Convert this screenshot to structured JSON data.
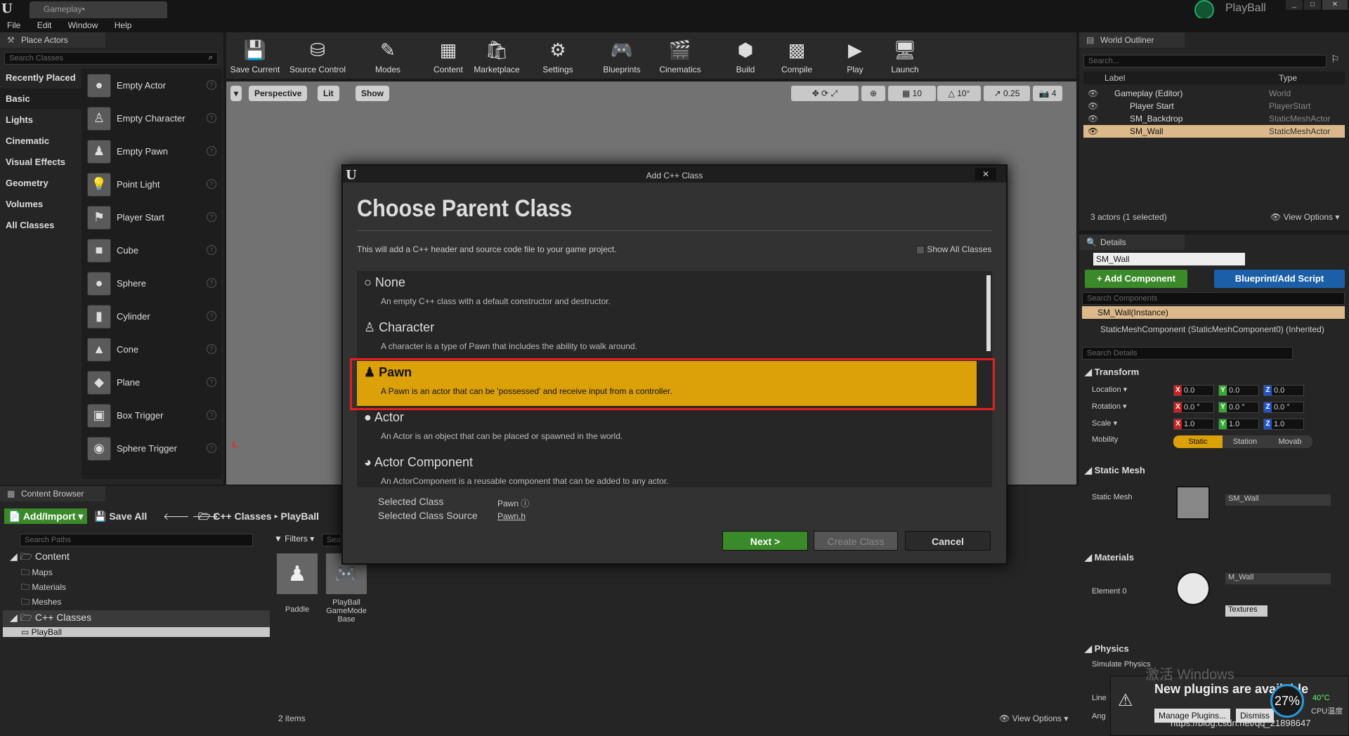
{
  "window": {
    "app_logo": "U",
    "doc_tab": "Gameplay•",
    "project_name": "PlayBall"
  },
  "menu": [
    "File",
    "Edit",
    "Window",
    "Help"
  ],
  "place_actors": {
    "tab": "Place Actors",
    "search_placeholder": "Search Classes",
    "categories": [
      "Recently Placed",
      "Basic",
      "Lights",
      "Cinematic",
      "Visual Effects",
      "Geometry",
      "Volumes",
      "All Classes"
    ],
    "selected_category": "Basic",
    "items": [
      "Empty Actor",
      "Empty Character",
      "Empty Pawn",
      "Point Light",
      "Player Start",
      "Cube",
      "Sphere",
      "Cylinder",
      "Cone",
      "Plane",
      "Box Trigger",
      "Sphere Trigger"
    ]
  },
  "toolbar": {
    "buttons": [
      "Save Current",
      "Source Control",
      "Modes",
      "Content",
      "Marketplace",
      "Settings",
      "Blueprints",
      "Cinematics",
      "Build",
      "Compile",
      "Play",
      "Launch"
    ]
  },
  "viewport": {
    "perspective": "Perspective",
    "lit": "Lit",
    "show": "Show",
    "grid_snap": "10",
    "rotation_snap": "10°",
    "scale_snap": "0.25",
    "camera_speed": "4"
  },
  "world_outliner": {
    "tab": "World Outliner",
    "search_placeholder": "Search...",
    "col_label": "Label",
    "col_type": "Type",
    "rows": [
      {
        "label": "Gameplay (Editor)",
        "type": "World"
      },
      {
        "label": "Player Start",
        "type": "PlayerStart"
      },
      {
        "label": "SM_Backdrop",
        "type": "StaticMeshActor"
      },
      {
        "label": "SM_Wall",
        "type": "StaticMeshActor"
      }
    ],
    "status": "3 actors (1 selected)",
    "view_options": "View Options"
  },
  "details": {
    "tab": "Details",
    "name": "SM_Wall",
    "add_component": "+ Add Component",
    "blueprint_script": "Blueprint/Add Script",
    "search_components": "Search Components",
    "instance": "SM_Wall(Instance)",
    "component": "StaticMeshComponent (StaticMeshComponent0) (Inherited)",
    "search_details": "Search Details",
    "transform_header": "Transform",
    "location_label": "Location",
    "rotation_label": "Rotation",
    "scale_label": "Scale",
    "mobility_label": "Mobility",
    "location": [
      "0.0",
      "0.0",
      "0.0"
    ],
    "rotation": [
      "0.0 °",
      "0.0 °",
      "0.0 °"
    ],
    "scale": [
      "1.0",
      "1.0",
      "1.0"
    ],
    "mobility": [
      "Static",
      "Station",
      "Movab"
    ],
    "static_mesh_header": "Static Mesh",
    "static_mesh_label": "Static Mesh",
    "static_mesh_value": "SM_Wall",
    "materials_header": "Materials",
    "element_label": "Element 0",
    "material_value": "M_Wall",
    "textures": "Textures",
    "physics_header": "Physics",
    "simulate_physics": "Simulate Physics",
    "line": "Line",
    "ang": "Ang"
  },
  "content_browser": {
    "tab": "Content Browser",
    "add_import": "Add/Import",
    "save_all": "Save All",
    "path": [
      "C++ Classes",
      "PlayBall"
    ],
    "search_paths": "Search Paths",
    "filters": "Filters",
    "search_assets": "Sea",
    "tree": [
      {
        "label": "Content",
        "level": 0
      },
      {
        "label": "Maps",
        "level": 1
      },
      {
        "label": "Materials",
        "level": 1
      },
      {
        "label": "Meshes",
        "level": 1
      },
      {
        "label": "C++ Classes",
        "level": 0
      },
      {
        "label": "PlayBall",
        "level": 1
      }
    ],
    "assets": [
      "Paddle",
      "PlayBall GameMode Base"
    ],
    "items_count": "2 items",
    "view_options": "View Options"
  },
  "dialog": {
    "title": "Add C++ Class",
    "heading": "Choose Parent Class",
    "description": "This will add a C++ header and source code file to your game project.",
    "show_all_classes": "Show All Classes",
    "classes": [
      {
        "name": "None",
        "desc": "An empty C++ class with a default constructor and destructor."
      },
      {
        "name": "Character",
        "desc": "A character is a type of Pawn that includes the ability to walk around."
      },
      {
        "name": "Pawn",
        "desc": "A Pawn is an actor that can be 'possessed' and receive input from a controller."
      },
      {
        "name": "Actor",
        "desc": "An Actor is an object that can be placed or spawned in the world."
      },
      {
        "name": "Actor Component",
        "desc": "An ActorComponent is a reusable component that can be added to any actor."
      }
    ],
    "selected_index": 2,
    "selected_class_label": "Selected Class",
    "selected_class_value": "Pawn",
    "selected_source_label": "Selected Class Source",
    "selected_source_value": "Pawn.h",
    "next_button": "Next >",
    "create_button": "Create Class",
    "cancel_button": "Cancel"
  },
  "notification": {
    "text": "New plugins are available",
    "manage": "Manage Plugins...",
    "dismiss": "Dismiss"
  },
  "overlay": {
    "activate_windows": "激活 Windows",
    "cpu_percent": "27%",
    "cpu_temp": "40°C",
    "cpu_label": "CPU温度",
    "watermark": "https://blog.csdn.net/qq_21898647"
  },
  "colors": {
    "accent_orange": "#dca108",
    "green_button": "#3a8a2a",
    "blue_button": "#1a5fa8",
    "selection_red": "#e02020"
  }
}
